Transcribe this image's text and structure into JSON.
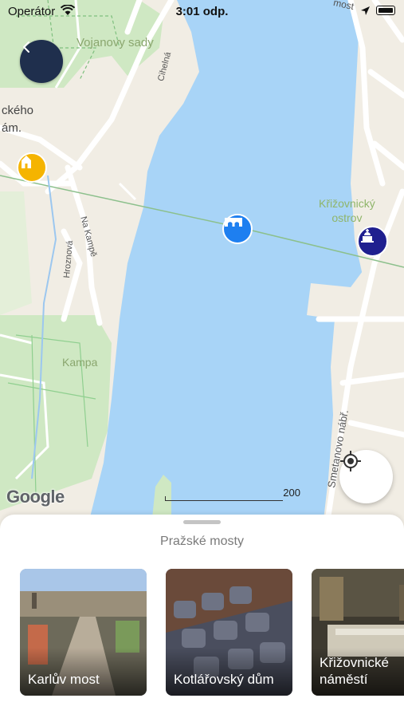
{
  "status_bar": {
    "carrier": "Operátor",
    "time": "3:01 odp."
  },
  "map": {
    "labels": {
      "park_north": "Vojanovy sady",
      "square_partial_1": "ckého",
      "square_partial_2": "ám.",
      "park_south": "Kampa",
      "island": "Křižovnický\nostrov"
    },
    "streets": {
      "cihelna": "Cihelná",
      "na_kampe": "Na Kampě",
      "hroznova": "Hroznová",
      "smetanovo": "Smetanovo nábř.",
      "most_partial": "most"
    },
    "attribution": "Google",
    "scale_label": "200",
    "colors": {
      "water": "#a8d4f7",
      "land": "#f1ede4",
      "park": "#cfe8c3",
      "road": "#ffffff",
      "back_button": "#1f2f4d"
    }
  },
  "pins": [
    {
      "name": "church-pin",
      "color": "#f5b400",
      "icon": "church-icon"
    },
    {
      "name": "bridge-pin",
      "color": "#1e7ff0",
      "icon": "bridge-icon"
    },
    {
      "name": "monument-pin",
      "color": "#1f1f8f",
      "icon": "monument-icon"
    }
  ],
  "sheet": {
    "title": "Pražské mosty",
    "cards": [
      {
        "label": "Karlův most"
      },
      {
        "label": "Kotlářovský dům"
      },
      {
        "label": "Křižovnické náměstí"
      }
    ]
  }
}
